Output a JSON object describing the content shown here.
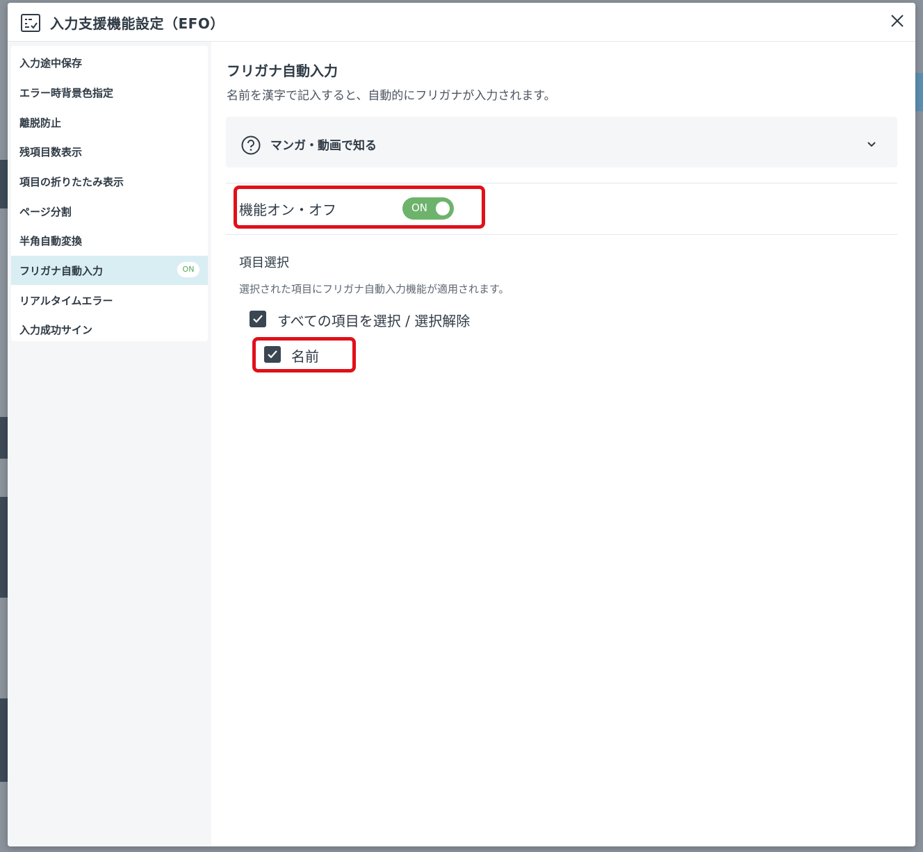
{
  "modal": {
    "title": "入力支援機能設定（EFO）",
    "header_icon": "checklist-icon",
    "close_icon": "close-icon"
  },
  "sidebar": {
    "items": [
      {
        "label": "入力途中保存"
      },
      {
        "label": "エラー時背景色指定"
      },
      {
        "label": "離脱防止"
      },
      {
        "label": "残項目数表示"
      },
      {
        "label": "項目の折りたたみ表示"
      },
      {
        "label": "ページ分割"
      },
      {
        "label": "半角自動変換"
      },
      {
        "label": "フリガナ自動入力",
        "active": true,
        "badge": "ON"
      },
      {
        "label": "リアルタイムエラー"
      },
      {
        "label": "入力成功サイン"
      }
    ]
  },
  "main": {
    "title": "フリガナ自動入力",
    "description": "名前を漢字で記入すると、自動的にフリガナが入力されます。",
    "help": {
      "icon": "question-circle-icon",
      "label": "マンガ・動画で知る",
      "chevron_icon": "chevron-down-icon"
    },
    "toggle": {
      "label": "機能オン・オフ",
      "state_text": "ON",
      "on": true
    },
    "field_select": {
      "heading": "項目選択",
      "description": "選択された項目にフリガナ自動入力機能が適用されます。",
      "select_all_label": "すべての項目を選択 / 選択解除",
      "select_all_checked": true,
      "items": [
        {
          "label": "名前",
          "checked": true
        }
      ]
    }
  },
  "colors": {
    "accent_green": "#6db36b",
    "active_bg": "#d9eef3",
    "highlight_red": "#e0101a",
    "checkbox_dark": "#3a4652"
  }
}
